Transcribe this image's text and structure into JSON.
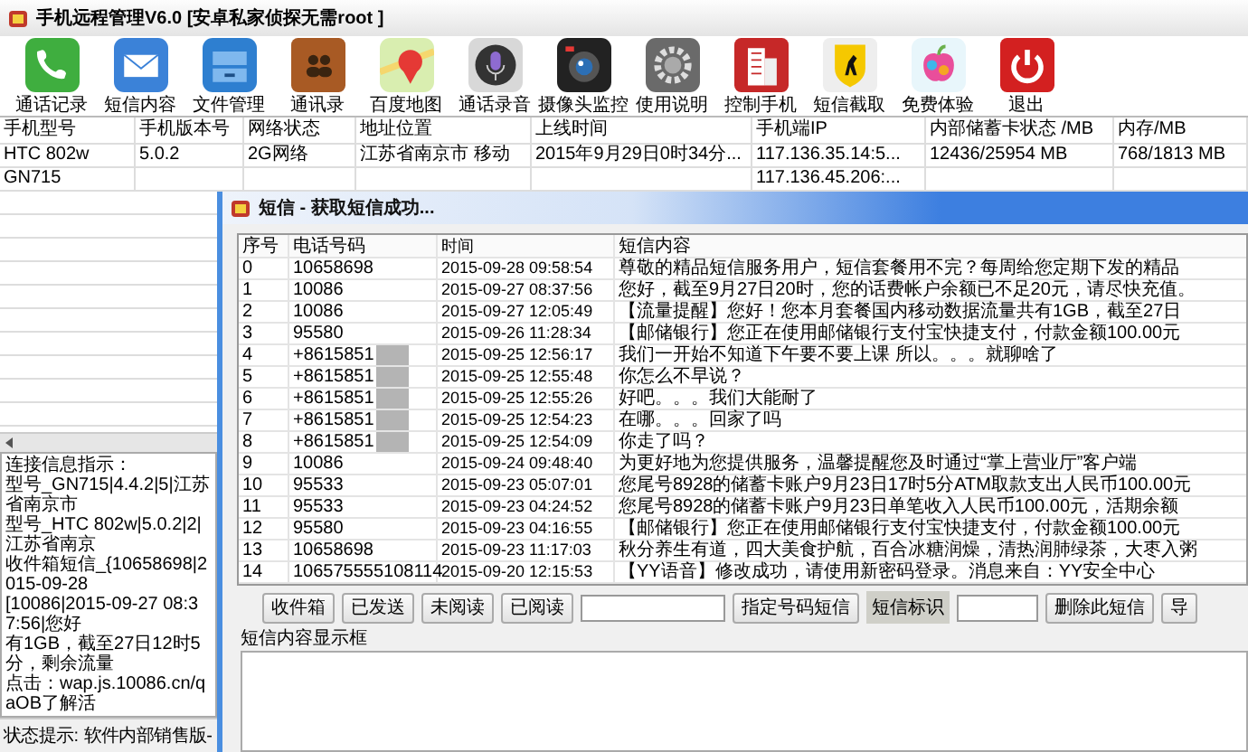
{
  "window": {
    "title": "手机远程管理V6.0 [安卓私家侦探无需root ]"
  },
  "toolbar": [
    {
      "label": "通话记录"
    },
    {
      "label": "短信内容"
    },
    {
      "label": "文件管理"
    },
    {
      "label": "通讯录"
    },
    {
      "label": "百度地图"
    },
    {
      "label": "通话录音"
    },
    {
      "label": "摄像头监控"
    },
    {
      "label": "使用说明"
    },
    {
      "label": "控制手机"
    },
    {
      "label": "短信截取"
    },
    {
      "label": "免费体验"
    },
    {
      "label": "退出"
    }
  ],
  "device_table": {
    "columns": [
      "手机型号",
      "手机版本号",
      "网络状态",
      "地址位置",
      "上线时间",
      "手机端IP",
      "内部储蓄卡状态 /MB",
      "内存/MB"
    ],
    "rows": [
      [
        "HTC 802w",
        "5.0.2",
        "2G网络",
        "江苏省南京市 移动",
        "2015年9月29日0时34分...",
        "117.136.35.14:5...",
        "12436/25954 MB",
        "768/1813 MB"
      ],
      [
        "GN715",
        null,
        null,
        null,
        null,
        "117.136.45.206:...",
        null,
        null
      ]
    ]
  },
  "log": {
    "title": "连接信息指示：",
    "lines": [
      "型号_GN715|4.4.2|5|江苏省南京市",
      "型号_HTC 802w|5.0.2|2|江苏省南京",
      "收件箱短信_{10658698|2015-09-28",
      "[10086|2015-09-27 08:37:56|您好",
      "有1GB，截至27日12时5分，剩余流量",
      "点击：wap.js.10086.cn/qaOB了解活"
    ]
  },
  "status_bar": {
    "label": "状态提示:",
    "value": "软件内部销售版-"
  },
  "sms_dialog": {
    "title": "短信 - 获取短信成功...",
    "columns": [
      "序号",
      "电话号码",
      "时间",
      "短信内容"
    ],
    "rows": [
      {
        "cells": [
          "0",
          "10658698",
          "2015-09-28 09:58:54",
          "尊敬的精品短信服务用户，短信套餐用不完？每周给您定期下发的精品"
        ],
        "redacted": false
      },
      {
        "cells": [
          "1",
          "10086",
          "2015-09-27 08:37:56",
          "您好，截至9月27日20时，您的话费帐户余额已不足20元，请尽快充值。"
        ],
        "redacted": false
      },
      {
        "cells": [
          "2",
          "10086",
          "2015-09-27 12:05:49",
          "【流量提醒】您好！您本月套餐国内移动数据流量共有1GB，截至27日"
        ],
        "redacted": false
      },
      {
        "cells": [
          "3",
          "95580",
          "2015-09-26 11:28:34",
          "【邮储银行】您正在使用邮储银行支付宝快捷支付，付款金额100.00元"
        ],
        "redacted": false
      },
      {
        "cells": [
          "4",
          "+8615851",
          "2015-09-25 12:56:17",
          "我们一开始不知道下午要不要上课 所以。。。就聊啥了"
        ],
        "redacted": true
      },
      {
        "cells": [
          "5",
          "+8615851",
          "2015-09-25 12:55:48",
          "你怎么不早说？"
        ],
        "redacted": true
      },
      {
        "cells": [
          "6",
          "+8615851",
          "2015-09-25 12:55:26",
          "好吧。。。我们大能耐了"
        ],
        "redacted": true
      },
      {
        "cells": [
          "7",
          "+8615851",
          "2015-09-25 12:54:23",
          "在哪。。。回家了吗"
        ],
        "redacted": true
      },
      {
        "cells": [
          "8",
          "+8615851",
          "2015-09-25 12:54:09",
          "你走了吗？"
        ],
        "redacted": true
      },
      {
        "cells": [
          "9",
          "10086",
          "2015-09-24 09:48:40",
          "为更好地为您提供服务，温馨提醒您及时通过“掌上营业厅”客户端"
        ],
        "redacted": false
      },
      {
        "cells": [
          "10",
          "95533",
          "2015-09-23 05:07:01",
          "您尾号8928的储蓄卡账户9月23日17时5分ATM取款支出人民币100.00元"
        ],
        "redacted": false
      },
      {
        "cells": [
          "11",
          "95533",
          "2015-09-23 04:24:52",
          "您尾号8928的储蓄卡账户9月23日单笔收入人民币100.00元，活期余额"
        ],
        "redacted": false
      },
      {
        "cells": [
          "12",
          "95580",
          "2015-09-23 04:16:55",
          "【邮储银行】您正在使用邮储银行支付宝快捷支付，付款金额100.00元"
        ],
        "redacted": false
      },
      {
        "cells": [
          "13",
          "10658698",
          "2015-09-23 11:17:03",
          "秋分养生有道，四大美食护航，百合冰糖润燥，清热润肺绿茶，大枣入粥"
        ],
        "redacted": false
      },
      {
        "cells": [
          "14",
          "106575555108114",
          "2015-09-20 12:15:53",
          "【YY语音】修改成功，请使用新密码登录。消息来自：YY安全中心"
        ],
        "redacted": false
      }
    ],
    "folder_buttons": [
      "收件箱",
      "已发送",
      "未阅读",
      "已阅读"
    ],
    "number_button": "指定号码短信",
    "id_label": "短信标识",
    "action_buttons": [
      "删除此短信",
      "导"
    ],
    "content_box": {
      "label": "短信内容显示框"
    }
  }
}
